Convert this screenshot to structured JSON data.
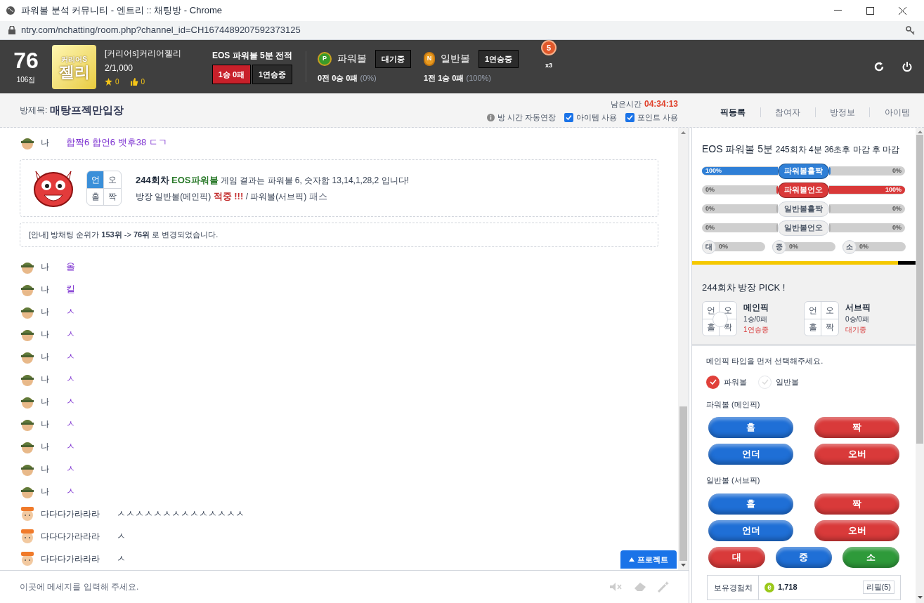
{
  "window": {
    "title": "파워볼 분석 커뮤니티 - 엔트리 :: 채팅방 - Chrome",
    "url": "ntry.com/nchatting/room.php?channel_id=CH1674489207592373125"
  },
  "header": {
    "rank": "76",
    "score": "106점",
    "logo": {
      "top": "커리어S",
      "main": "젤리"
    },
    "name": "[커리어s]커리어젤리",
    "members": "2/1,000",
    "stars": "0",
    "likes": "0",
    "record": {
      "title": "EOS 파워볼 5분 전적",
      "result": "1승 0패",
      "streak": "1연승중"
    },
    "games": [
      {
        "kind": "power",
        "badge": "P",
        "name": "파워볼",
        "status": "대기중",
        "stats": "0전 0승 0패",
        "rate": "(0%)"
      },
      {
        "kind": "normal",
        "badge": "N",
        "name": "일반볼",
        "status": "1연승중",
        "stats": "1전 1승 0패",
        "rate": "(100%)"
      }
    ],
    "medal": {
      "number": "5",
      "count": "x3"
    }
  },
  "room": {
    "label": "방제목:",
    "title": "매탕프젝만입장",
    "time_label": "남은시간",
    "time": "04:34:13",
    "options": [
      {
        "kind": "info",
        "label": "방 시간 자동연장"
      },
      {
        "kind": "checkbox",
        "label": "아이템 사용",
        "checked": true
      },
      {
        "kind": "checkbox",
        "label": "포인트 사용",
        "checked": true
      }
    ]
  },
  "tabs": [
    {
      "label": "픽등록",
      "selected": true
    },
    {
      "label": "참여자",
      "selected": false
    },
    {
      "label": "방정보",
      "selected": false
    },
    {
      "label": "아이템",
      "selected": false
    }
  ],
  "chat": [
    {
      "kind": "my_message",
      "user": "나",
      "text": "합짝6 합언6 뱃후38 ㄷㄱ"
    },
    {
      "kind": "result",
      "grid": [
        {
          "label": "언",
          "selected": true
        },
        {
          "label": "오",
          "selected": false
        },
        {
          "label": "홀",
          "selected": false
        },
        {
          "label": "짝",
          "selected": false
        }
      ],
      "round": "244회차",
      "game": "EOS파워볼",
      "line1": "게임 결과는 파워볼 6, 숫자합 13,14,1,28,2 입니다!",
      "line2": "방장 일반볼(메인픽)",
      "hit": "적중 !!!",
      "line2b": "/ 파워볼(서브픽)",
      "pass": "패스"
    },
    {
      "kind": "notice",
      "prefix": "[안내] 방채팅 순위가",
      "from": "153위",
      "arrow": "->",
      "to": "76위",
      "suffix": "로 변경되었습니다."
    },
    {
      "kind": "my_message",
      "user": "나",
      "text": "올"
    },
    {
      "kind": "my_message",
      "user": "나",
      "text": "킬"
    },
    {
      "kind": "my_message",
      "user": "나",
      "text": "ㅅ"
    },
    {
      "kind": "my_message",
      "user": "나",
      "text": "ㅅ"
    },
    {
      "kind": "my_message",
      "user": "나",
      "text": "ㅅ"
    },
    {
      "kind": "my_message",
      "user": "나",
      "text": "ㅅ"
    },
    {
      "kind": "my_message",
      "user": "나",
      "text": "ㅅ"
    },
    {
      "kind": "my_message",
      "user": "나",
      "text": "ㅅ"
    },
    {
      "kind": "my_message",
      "user": "나",
      "text": "ㅅ"
    },
    {
      "kind": "my_message",
      "user": "나",
      "text": "ㅅ"
    },
    {
      "kind": "my_message",
      "user": "나",
      "text": "ㅅ"
    },
    {
      "kind": "user_message",
      "user": "다다다가라라라",
      "text": "ㅅㅅㅅㅅㅅㅅㅅㅅㅅㅅㅅㅅㅅㅅ"
    },
    {
      "kind": "user_message",
      "user": "다다다가라라라",
      "text": "ㅅ"
    },
    {
      "kind": "user_message",
      "user": "다다다가라라라",
      "text": "ㅅ"
    }
  ],
  "project_button": "프로젝트",
  "input": {
    "placeholder": "이곳에 메세지를 입력해 주세요."
  },
  "panel": {
    "title": "EOS 파워볼 5분",
    "round_info": "245회차 4분 36초후 마감 후 마감",
    "bars": [
      {
        "label": "파워볼홀짝",
        "kind": "filled",
        "color": "#2f7fd6",
        "left": {
          "reading": "100%",
          "level": 1
        },
        "right": {
          "reading": "0%",
          "level": 0
        }
      },
      {
        "label": "파워볼언오",
        "kind": "filled",
        "color": "#d93838",
        "left": {
          "reading": "0%",
          "level": 0
        },
        "right": {
          "reading": "100%",
          "level": 1
        }
      },
      {
        "label": "일반볼홀짝",
        "kind": "plain",
        "left": {
          "reading": "0%",
          "level": 0
        },
        "right": {
          "reading": "0%",
          "level": 0
        }
      },
      {
        "label": "일반볼언오",
        "kind": "plain",
        "left": {
          "reading": "0%",
          "level": 0
        },
        "right": {
          "reading": "0%",
          "level": 0
        }
      }
    ],
    "sizes": [
      {
        "label": "대",
        "reading": "0%",
        "level": 0
      },
      {
        "label": "중",
        "reading": "0%",
        "level": 0
      },
      {
        "label": "소",
        "reading": "0%",
        "level": 0
      }
    ],
    "timer": {
      "level": 0.92
    },
    "pick": {
      "title": "244회차 방장 PICK !",
      "picks": [
        {
          "title": "메인픽",
          "record": "1승/0패",
          "status": "1연승중",
          "marked": true,
          "grid": [
            {
              "label": "언",
              "selected": false
            },
            {
              "label": "오",
              "selected": false
            },
            {
              "label": "홀",
              "selected": false
            },
            {
              "label": "짝",
              "selected": false
            }
          ]
        },
        {
          "title": "서브픽",
          "record": "0승/0패",
          "status": "대기중",
          "marked": false,
          "grid": [
            {
              "label": "언",
              "selected": false
            },
            {
              "label": "오",
              "selected": false
            },
            {
              "label": "홀",
              "selected": false
            },
            {
              "label": "짝",
              "selected": false
            }
          ]
        }
      ]
    },
    "instruction": "메인픽 타입을 먼저 선택해주세요.",
    "types": [
      {
        "label": "파워볼",
        "checked": true
      },
      {
        "label": "일반볼",
        "checked": false
      }
    ],
    "groups": [
      {
        "title": "파워볼 (메인픽)",
        "buttons": [
          {
            "label": "홀",
            "color": "#1f6fd6"
          },
          {
            "label": "짝",
            "color": "#d93a3a"
          },
          {
            "label": "언더",
            "color": "#1f6fd6"
          },
          {
            "label": "오버",
            "color": "#d93a3a"
          }
        ]
      },
      {
        "title": "일반볼 (서브픽)",
        "buttons": [
          {
            "label": "홀",
            "color": "#1f6fd6"
          },
          {
            "label": "짝",
            "color": "#d93a3a"
          },
          {
            "label": "언더",
            "color": "#1f6fd6"
          },
          {
            "label": "오버",
            "color": "#d93a3a"
          }
        ],
        "sizes": [
          {
            "label": "대",
            "color": "#d93a3a"
          },
          {
            "label": "중",
            "color": "#1f6fd6"
          },
          {
            "label": "소",
            "color": "#2e9a3a"
          }
        ]
      }
    ],
    "exp": {
      "label": "보유경험치",
      "badge": "e",
      "value": "1,718",
      "button": "리필(5)"
    }
  }
}
